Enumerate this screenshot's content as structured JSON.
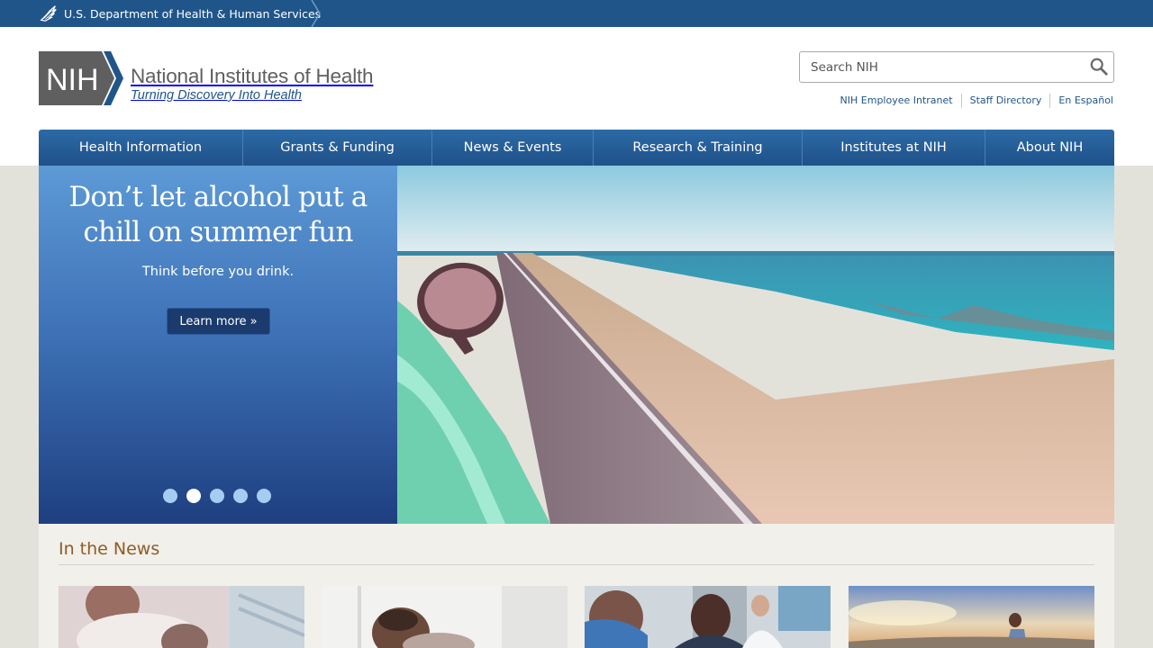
{
  "hhs": {
    "label": "U.S. Department of Health & Human Services"
  },
  "logo": {
    "abbr": "NIH",
    "name": "National Institutes of Health",
    "tagline": "Turning Discovery Into Health"
  },
  "search": {
    "placeholder": "Search NIH"
  },
  "util_links": [
    "NIH Employee Intranet",
    "Staff Directory",
    "En Español"
  ],
  "nav": [
    "Health Information",
    "Grants & Funding",
    "News & Events",
    "Research & Training",
    "Institutes at NIH",
    "About NIH"
  ],
  "hero": {
    "title": "Don’t let alcohol put a chill on summer fun",
    "subtitle": "Think before you drink.",
    "button": "Learn more »",
    "slide_count": 5,
    "active_slide": 2
  },
  "news": {
    "heading": "In the News"
  },
  "colors": {
    "hhs_bar": "#20558a",
    "nav": "#1f5189",
    "news_heading": "#8e5c27",
    "link": "#20558a"
  },
  "icons": [
    "hhs-eagle-icon",
    "search-icon"
  ]
}
